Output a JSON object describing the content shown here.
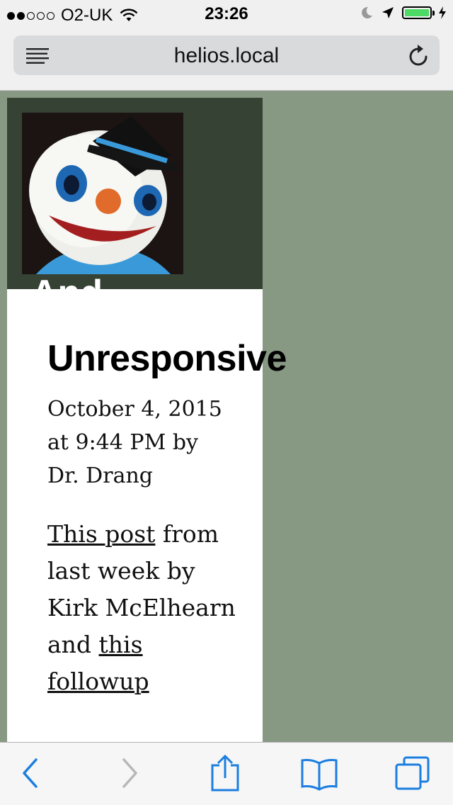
{
  "status_bar": {
    "carrier": "O2-UK",
    "time": "23:26",
    "signal_filled": 2,
    "signal_total": 5,
    "battery_level": 1.0,
    "battery_color": "#4cd964"
  },
  "address_bar": {
    "url": "helios.local",
    "reader_icon": "reader-view-icon",
    "reload_icon": "reload-icon"
  },
  "page": {
    "header_bg": "#364233",
    "page_bg": "#879883",
    "site_title_peek": "And",
    "post": {
      "title": "Unresponsive",
      "date": "October 4, 2015",
      "time": "at 9:44 PM by",
      "author": "Dr. Drang",
      "body_link1": "This post",
      "body_text1": " from last week by Kirk McElhearn and ",
      "body_link2": "this followup"
    }
  },
  "bottom_toolbar": {
    "back": "back-chevron-icon",
    "forward": "forward-chevron-icon",
    "share": "share-icon",
    "bookmarks": "bookmarks-icon",
    "tabs": "tabs-icon",
    "accent": "#1b7ee0"
  }
}
